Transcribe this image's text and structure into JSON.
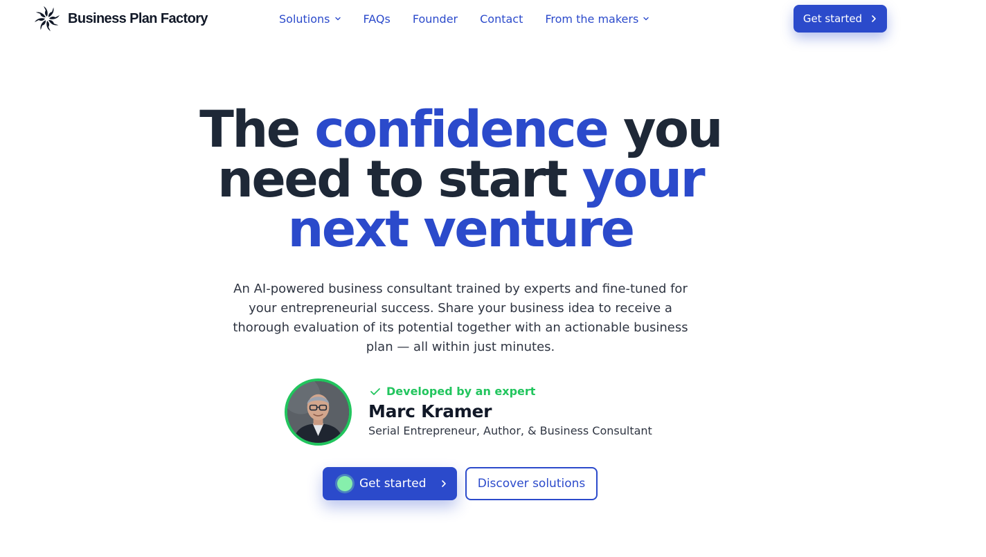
{
  "header": {
    "brand": "Business Plan Factory",
    "nav": [
      {
        "label": "Solutions",
        "dropdown": true
      },
      {
        "label": "FAQs",
        "dropdown": false
      },
      {
        "label": "Founder",
        "dropdown": false
      },
      {
        "label": "Contact",
        "dropdown": false
      },
      {
        "label": "From the makers",
        "dropdown": true
      }
    ],
    "cta_label": "Get started"
  },
  "hero": {
    "title_parts": {
      "p1": "The ",
      "p2": "confidence",
      "p3": " you need to start ",
      "p4": "your next venture"
    },
    "subtitle": "An AI-powered business consultant trained by experts and fine-tuned for your entrepreneurial success. Share your business idea to receive a thorough evaluation of its potential together with an actionable business plan — all within just minutes."
  },
  "expert": {
    "badge": "Developed by an expert",
    "name": "Marc Kramer",
    "role": "Serial Entrepreneur, Author, & Business Consultant",
    "avatar_icon": "person-portrait"
  },
  "actions": {
    "primary_label": "Get started",
    "secondary_label": "Discover solutions"
  },
  "colors": {
    "accent": "#2b4acb",
    "heading": "#1e2837",
    "success": "#22c55e",
    "pulse": "#86efac"
  }
}
